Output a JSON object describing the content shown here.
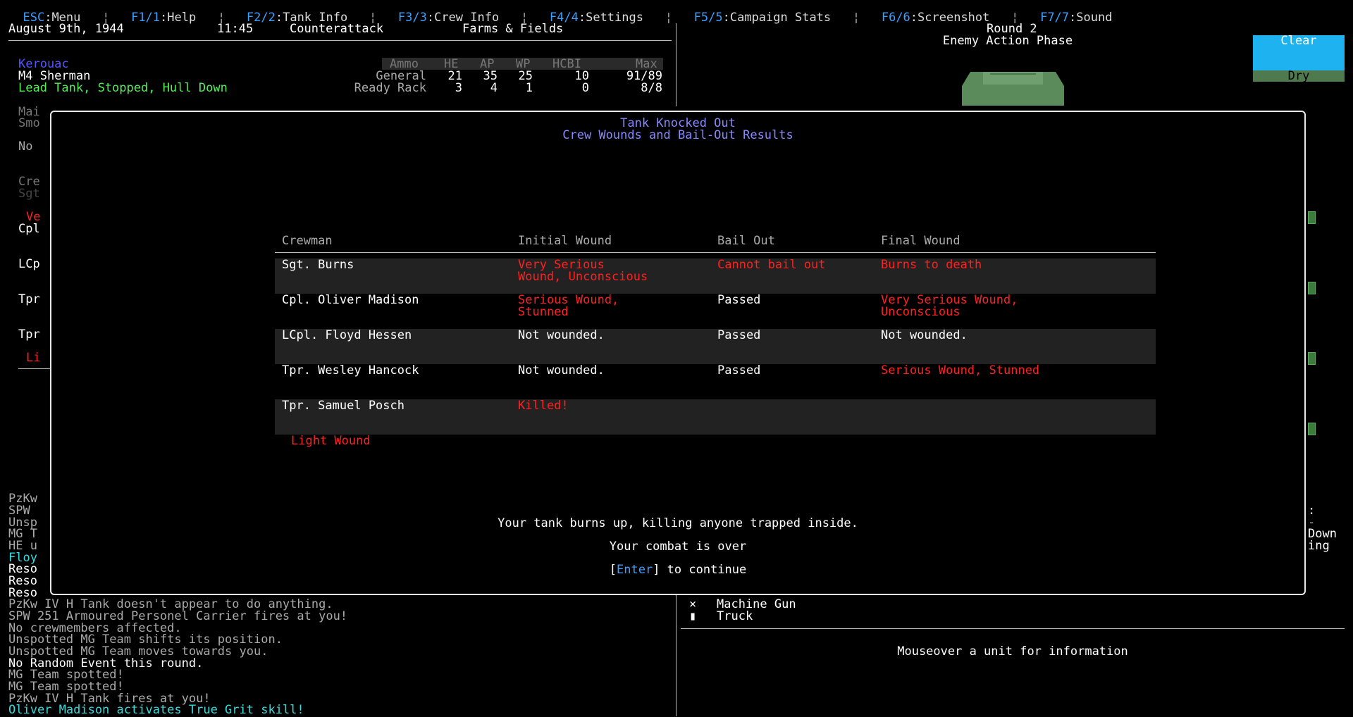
{
  "menu": [
    {
      "key": "ESC",
      "label": ":Menu"
    },
    {
      "key": "F1/1",
      "label": ":Help"
    },
    {
      "key": "F2/2",
      "label": ":Tank Info"
    },
    {
      "key": "F3/3",
      "label": ":Crew Info"
    },
    {
      "key": "F4/4",
      "label": ":Settings"
    },
    {
      "key": "F5/5",
      "label": ":Campaign Stats"
    },
    {
      "key": "F6/6",
      "label": ":Screenshot"
    },
    {
      "key": "F7/7",
      "label": ":Sound"
    }
  ],
  "header": {
    "date": "August 9th, 1944",
    "time": "11:45",
    "mission": "Counterattack",
    "terrain": "Farms & Fields",
    "round": "Round 2",
    "phase": "Enemy Action Phase"
  },
  "tank": {
    "name": "Kerouac",
    "model": "M4 Sherman",
    "status": "Lead Tank, Stopped, Hull Down"
  },
  "ammo": {
    "headers": [
      "Ammo",
      "HE",
      "AP",
      "WP",
      "HCBI",
      "Max"
    ],
    "rows": [
      [
        "General",
        "21",
        "35",
        "25",
        "10",
        "91/89"
      ],
      [
        "Ready Rack",
        "3",
        "4",
        "1",
        "0",
        "8/8"
      ]
    ]
  },
  "weather": {
    "sky": "Clear",
    "ground": "Dry"
  },
  "left_fragments": {
    "mai": "Mai",
    "smo": "Smo",
    "no": "No",
    "cre": "Cre",
    "sgt": "Sgt",
    "ve": "Ve",
    "cpl": "Cpl",
    "lcp": "LCp",
    "tpr1": "Tpr",
    "tpr2": "Tpr",
    "li": "Li",
    "log_cut": [
      "PzKw",
      "SPW",
      "Unsp",
      "MG T",
      "HE u",
      "Floy",
      "Reso",
      "Reso",
      "Reso"
    ]
  },
  "right_fragments": {
    "colon": ":",
    "dash": "-",
    "down": "Down",
    "ing": "ing"
  },
  "modal": {
    "title": "Tank Knocked Out",
    "subtitle": "Crew Wounds and Bail-Out Results",
    "columns": [
      "Crewman",
      "Initial Wound",
      "Bail Out",
      "Final Wound"
    ],
    "crew": [
      {
        "name": "Sgt. Burns",
        "initial": [
          "Very Serious",
          "Wound, Unconscious"
        ],
        "bail": "Cannot bail out",
        "final": [
          "Burns to death"
        ],
        "initial_red": true,
        "bail_red": true,
        "final_red": true
      },
      {
        "name": "Cpl. Oliver Madison",
        "initial": [
          "Serious Wound,",
          "Stunned"
        ],
        "bail": "Passed",
        "final": [
          "Very Serious Wound,",
          "Unconscious"
        ],
        "initial_red": true,
        "bail_red": false,
        "final_red": true
      },
      {
        "name": "LCpl. Floyd Hessen",
        "initial": [
          "Not wounded."
        ],
        "bail": "Passed",
        "final": [
          "Not wounded."
        ],
        "initial_red": false,
        "bail_red": false,
        "final_red": false
      },
      {
        "name": "Tpr. Wesley Hancock",
        "initial": [
          "Not wounded."
        ],
        "bail": "Passed",
        "final": [
          "Serious Wound, Stunned"
        ],
        "initial_red": false,
        "bail_red": false,
        "final_red": true
      },
      {
        "name": "Tpr. Samuel Posch",
        "initial": [
          "Killed!"
        ],
        "bail": "",
        "final": [
          ""
        ],
        "initial_red": true,
        "bail_red": false,
        "final_red": false
      }
    ],
    "stray_label": "Light Wound",
    "message1": "Your tank burns up, killing anyone trapped inside.",
    "message2": "Your combat is over",
    "continue_key": "Enter",
    "continue_text": "] to continue",
    "continue_open": "["
  },
  "log": [
    {
      "text": "PzKw IV H Tank doesn't appear to do anything.",
      "color": "grey"
    },
    {
      "text": "SPW 251 Armoured Personel Carrier fires at you!",
      "color": "grey"
    },
    {
      "text": "No crewmembers affected.",
      "color": "grey"
    },
    {
      "text": "Unspotted MG Team shifts its position.",
      "color": "grey"
    },
    {
      "text": "Unspotted MG Team moves towards you.",
      "color": "grey"
    },
    {
      "text": "No Random Event this round.",
      "color": "white"
    },
    {
      "text": "MG Team spotted!",
      "color": "grey"
    },
    {
      "text": "MG Team spotted!",
      "color": "grey"
    },
    {
      "text": "PzKw IV H Tank fires at you!",
      "color": "grey"
    },
    {
      "text": "Oliver Madison activates True Grit skill!",
      "color": "cyan"
    }
  ],
  "units": [
    {
      "icon": "×",
      "label": "Machine Gun"
    },
    {
      "icon": "▮",
      "label": "Truck"
    }
  ],
  "unit_info": "Mouseover a unit for information"
}
